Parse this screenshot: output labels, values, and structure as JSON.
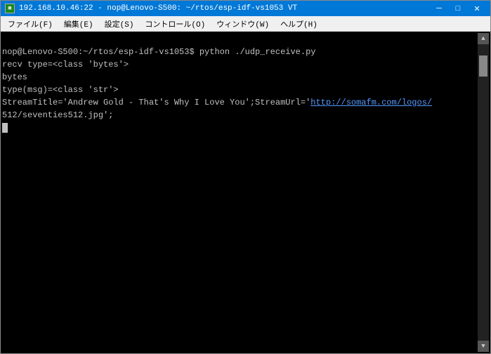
{
  "window": {
    "title": "192.168.10.46:22 - nop@Lenovo-S500: ~/rtos/esp-idf-vs1053 VT",
    "icon_label": "■"
  },
  "titlebar_controls": {
    "minimize": "─",
    "maximize": "□",
    "close": "✕"
  },
  "menu": {
    "items": [
      {
        "label": "ファイル(F)"
      },
      {
        "label": "編集(E)"
      },
      {
        "label": "設定(S)"
      },
      {
        "label": "コントロール(O)"
      },
      {
        "label": "ウィンドウ(W)"
      },
      {
        "label": "ヘルプ(H)"
      }
    ]
  },
  "terminal": {
    "lines": [
      "nop@Lenovo-S500:~/rtos/esp-idf-vs1053$ python ./udp_receive.py",
      "recv type=<class 'bytes'>",
      "bytes",
      "type(msg)=<class 'str'>",
      "StreamTitle='Andrew Gold - That's Why I Love You';StreamUrl='",
      "512/seventies512.jpg';"
    ],
    "link_part": "http://somafm.com/logos/",
    "cursor_line": ""
  }
}
